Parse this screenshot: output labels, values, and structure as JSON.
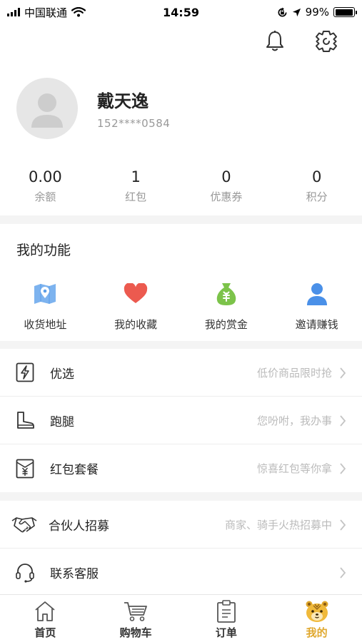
{
  "status_bar": {
    "carrier": "中国联通",
    "time": "14:59",
    "battery": "99%",
    "battery_level": 0.99,
    "icons": [
      "signal-icon",
      "wifi-icon",
      "lock-rotation-icon",
      "location-arrow-icon",
      "battery-icon"
    ]
  },
  "header_icons": [
    "bell-icon",
    "settings-gear-icon"
  ],
  "profile": {
    "name": "戴天逸",
    "phone": "152****0584"
  },
  "stats": [
    {
      "value": "0.00",
      "label": "余额"
    },
    {
      "value": "1",
      "label": "红包"
    },
    {
      "value": "0",
      "label": "优惠券"
    },
    {
      "value": "0",
      "label": "积分"
    }
  ],
  "functions": {
    "title": "我的功能",
    "items": [
      {
        "label": "收货地址",
        "icon": "map-icon",
        "color": "#5b9ee8"
      },
      {
        "label": "我的收藏",
        "icon": "heart-icon",
        "color": "#ec5a4f"
      },
      {
        "label": "我的赏金",
        "icon": "money-bag-icon",
        "color": "#7cc34a"
      },
      {
        "label": "邀请赚钱",
        "icon": "user-icon",
        "color": "#4a90e8"
      }
    ]
  },
  "menu_group_1": [
    {
      "label": "优选",
      "hint": "低价商品限时抢",
      "icon": "lightning-icon"
    },
    {
      "label": "跑腿",
      "hint": "您吩咐，我办事",
      "icon": "boot-icon"
    },
    {
      "label": "红包套餐",
      "hint": "惊喜红包等你拿",
      "icon": "red-envelope-icon"
    }
  ],
  "menu_group_2": [
    {
      "label": "合伙人招募",
      "hint": "商家、骑手火热招募中",
      "icon": "handshake-icon"
    },
    {
      "label": "联系客服",
      "hint": "",
      "icon": "headset-icon"
    }
  ],
  "tab_bar": [
    {
      "label": "首页",
      "icon": "home-icon",
      "active": false
    },
    {
      "label": "购物车",
      "icon": "cart-icon",
      "active": false
    },
    {
      "label": "订单",
      "icon": "order-clipboard-icon",
      "active": false
    },
    {
      "label": "我的",
      "icon": "tiger-face-icon",
      "active": true
    }
  ],
  "colors": {
    "accent": "#e0a82e",
    "hint_text": "#bbbbbb",
    "muted_text": "#999999",
    "background": "#f4f4f4"
  }
}
